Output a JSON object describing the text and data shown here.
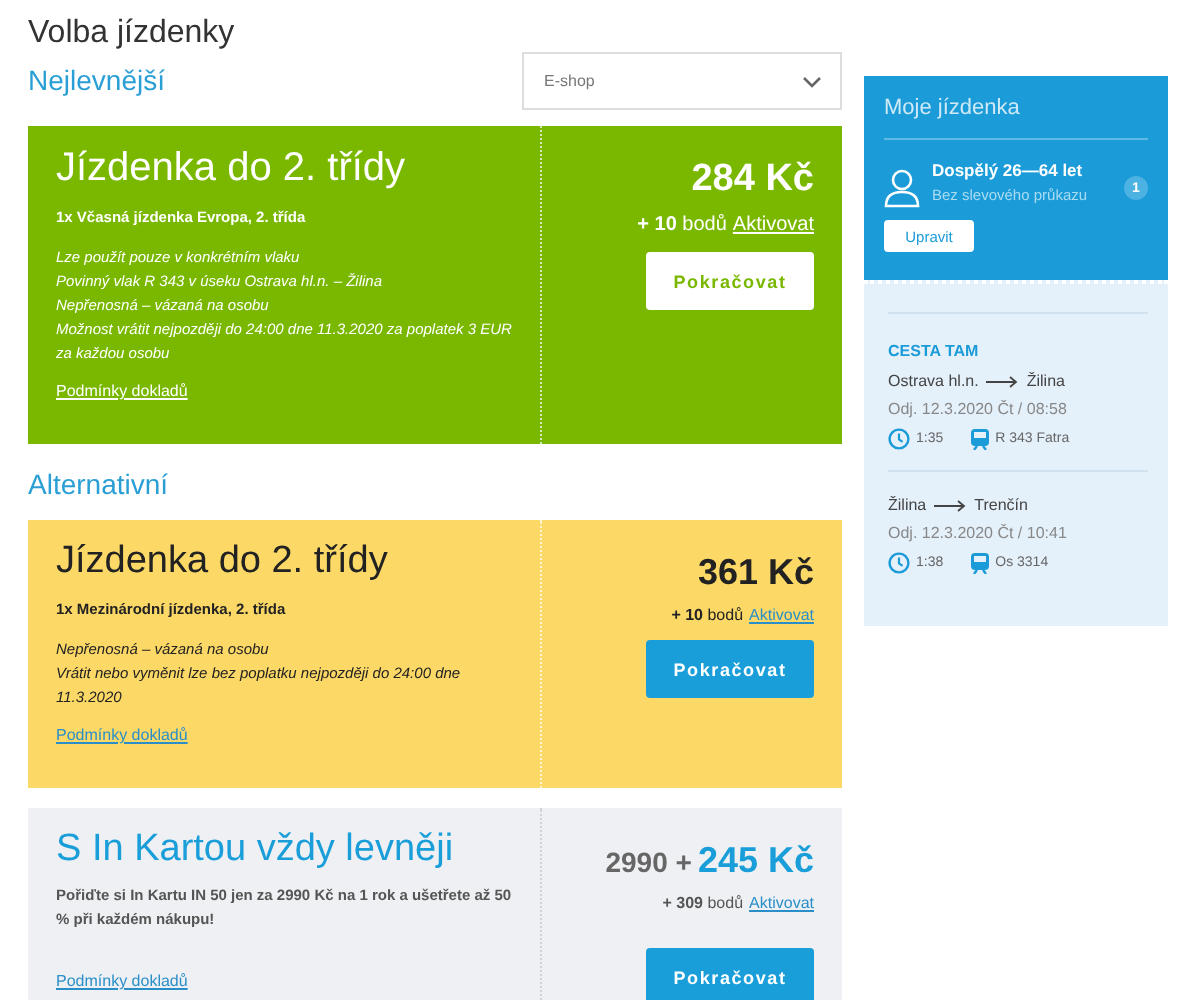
{
  "page_title": "Volba jízdenky",
  "channel_select": {
    "value": "E-shop"
  },
  "sections": [
    {
      "heading": "Nejlevnější",
      "offers": [
        {
          "kind": "featured",
          "title": "Jízdenka do 2. třídy",
          "subtitle": "1x Včasná jízdenka Evropa, 2. třída",
          "notes": [
            "Lze použít pouze v konkrétním vlaku",
            "Povinný vlak R 343 v úseku Ostrava hl.n. – Žilina",
            "Nepřenosná – vázaná na osobu",
            "Možnost vrátit nejpozději do 24:00 dne 11.3.2020 za poplatek 3 EUR za každou osobu"
          ],
          "conditions_link": "Podmínky dokladů",
          "price": "284 Kč",
          "points": "**+ 10** bodů",
          "activate_link": "Aktivovat",
          "button": "Pokračovat"
        }
      ]
    },
    {
      "heading": "Alternativní",
      "offers": [
        {
          "kind": "standard",
          "title": "Jízdenka do 2. třídy",
          "subtitle": "1x Mezinárodní jízdenka, 2. třída",
          "notes": [
            "Nepřenosná – vázaná na osobu",
            "Vrátit nebo vyměnit lze bez poplatku nejpozději do 24:00 dne 11.3.2020"
          ],
          "conditions_link": "Podmínky dokladů",
          "price": "361 Kč",
          "points": "**+ 10** bodů",
          "activate_link": "Aktivovat",
          "button": "Pokračovat"
        },
        {
          "kind": "promo",
          "title": "S In Kartou vždy levněji",
          "subtitle": "Pořiďte si In Kartu IN 50 jen za 2990 Kč na 1 rok a ušetřete až 50 % při každém nákupu!",
          "conditions_link": "Podmínky dokladů",
          "price_prefix": "2990 +",
          "price": "245 Kč",
          "points": "**+ 309** bodů",
          "activate_link": "Aktivovat",
          "button": "Pokračovat"
        }
      ]
    }
  ],
  "summary": {
    "title": "Moje jízdenka",
    "passenger": {
      "name": "Dospělý 26—64 let",
      "discount": "Bez slevového průkazu",
      "count": "1"
    },
    "edit_button": "Upravit",
    "journey_heading": "CESTA TAM",
    "legs": [
      {
        "from": "Ostrava hl.n.",
        "to": "Žilina",
        "departure": "Odj. 12.3.2020 Čt / 08:58",
        "duration": "1:35",
        "train": "R 343 Fatra"
      },
      {
        "from": "Žilina",
        "to": "Trenčín",
        "departure": "Odj. 12.3.2020 Čt / 10:41",
        "duration": "1:38",
        "train": "Os 3314"
      }
    ]
  }
}
